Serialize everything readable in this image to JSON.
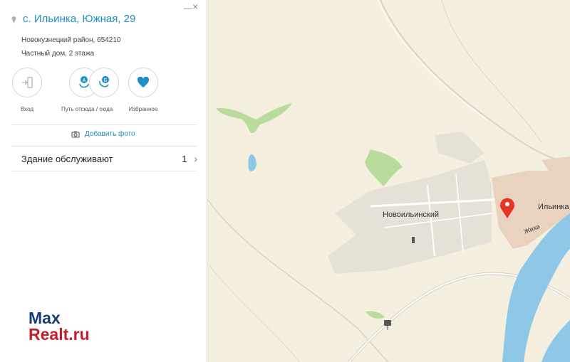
{
  "panel": {
    "title": "с. Ильинка, Южная, 29",
    "minimize_label": "—",
    "close_label": "×",
    "district_postcode": "Новокузнецкий район, 654210",
    "building_type": "Частный дом, 2 этажа",
    "actions": [
      {
        "label": "Вход",
        "icon": "entrance-icon"
      },
      {
        "label": "Путь отсюда / сюда",
        "icon": "route-icon"
      },
      {
        "label": "Избранное",
        "icon": "heart-icon"
      }
    ],
    "add_photo_label": "Добавить фото",
    "building_service_label": "Здание обслуживают",
    "building_service_count": "1",
    "chevron": "›"
  },
  "map": {
    "labels": {
      "novoilinsky": "Новоильинский",
      "ilinka": "Ильинка",
      "zhikha": "Жиха"
    },
    "colors": {
      "background": "#f5efdf",
      "river": "#8fc8e6",
      "green": "#b9dc9c",
      "settlement": "#e5e1d6",
      "village": "#ead3be",
      "marker": "#e53524"
    }
  },
  "watermark": {
    "line1": "Max",
    "line2": "Realt.ru"
  },
  "colors": {
    "accent": "#1f8fc7"
  }
}
